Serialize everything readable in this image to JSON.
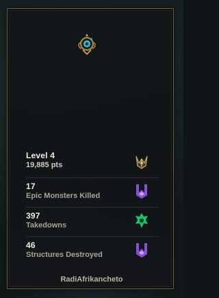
{
  "profile": {
    "level_label": "Level 4",
    "points_label": "19,885 pts",
    "player_name": "RadiAfrikancheto"
  },
  "stats": [
    {
      "value": "17",
      "label": "Epic Monsters Killed",
      "icon": "purple-token-icon",
      "color": "#8a4fd8"
    },
    {
      "value": "397",
      "label": "Takedowns",
      "icon": "green-token-icon",
      "color": "#1fbf6b"
    },
    {
      "value": "46",
      "label": "Structures Destroyed",
      "icon": "purple-token-icon",
      "color": "#8a4fd8"
    }
  ],
  "colors": {
    "border_gold": "#6f6148",
    "emblem_teal": "#2ec4d6",
    "crest_gold": "#c9a45a"
  }
}
